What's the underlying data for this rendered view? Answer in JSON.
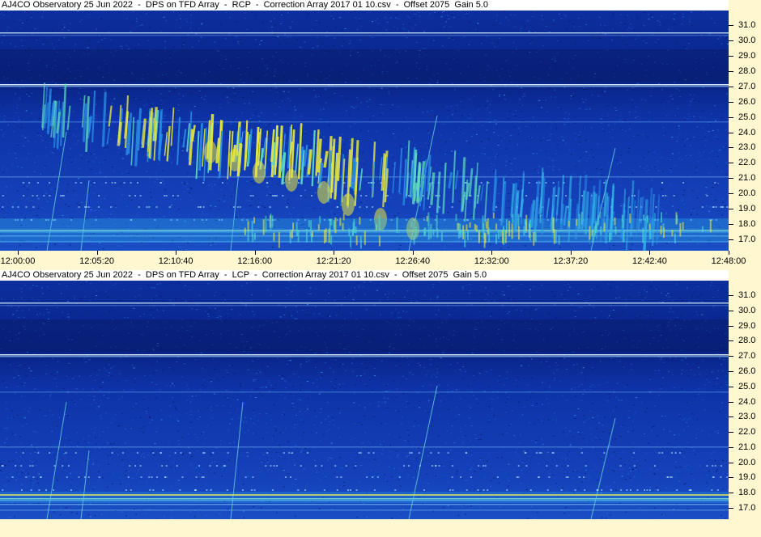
{
  "panels": [
    {
      "title": "AJ4CO Observatory 25 Jun 2022  -  DPS on TFD Array  -  RCP  -  Correction Array 2017 01 10.csv  -  Offset 2075  Gain 5.0",
      "polarization": "RCP",
      "burst": true
    },
    {
      "title": "AJ4CO Observatory 25 Jun 2022  -  DPS on TFD Array  -  LCP  -  Correction Array 2017 01 10.csv  -  Offset 2075  Gain 5.0",
      "polarization": "LCP",
      "burst": false
    }
  ],
  "frequency_axis": {
    "labels": [
      "31.0",
      "30.0",
      "29.0",
      "28.0",
      "27.0",
      "26.0",
      "25.0",
      "24.0",
      "23.0",
      "22.0",
      "21.0",
      "20.0",
      "19.0",
      "18.0",
      "17.0"
    ]
  },
  "time_axis": {
    "labels": [
      "12:00:00",
      "12:05:20",
      "12:10:40",
      "12:16:00",
      "12:21:20",
      "12:26:40",
      "12:32:00",
      "12:37:20",
      "12:42:40",
      "12:48:00"
    ]
  },
  "colors": {
    "background": "#fff7cf",
    "spectrogram_base": "#0a2a9a",
    "spectrogram_dark": "#061a66",
    "burst_cyan": "#38c8f0",
    "burst_yellow": "#e8e840",
    "band_line": "#c8f0ff"
  }
}
